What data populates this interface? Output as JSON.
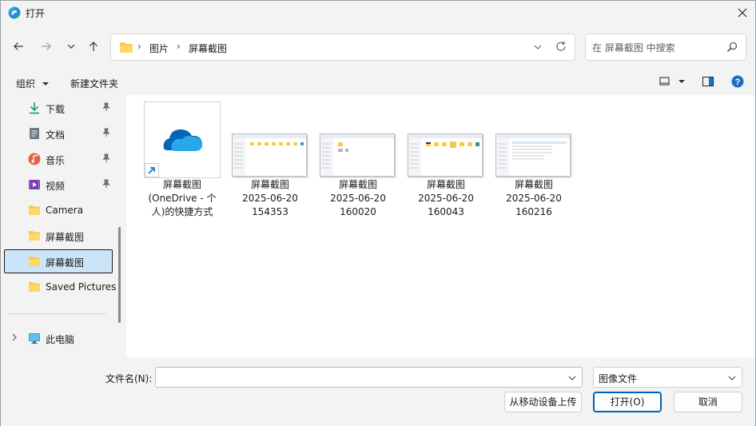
{
  "window": {
    "title": "打开"
  },
  "address": {
    "breadcrumbs": [
      "图片",
      "屏幕截图"
    ]
  },
  "search": {
    "placeholder": "在 屏幕截图 中搜索"
  },
  "commandbar": {
    "organize": "组织",
    "new_folder": "新建文件夹"
  },
  "sidebar": {
    "items": [
      {
        "label": "下载",
        "icon": "download-icon",
        "pinned": true
      },
      {
        "label": "文档",
        "icon": "document-icon",
        "pinned": true
      },
      {
        "label": "音乐",
        "icon": "music-icon",
        "pinned": true
      },
      {
        "label": "视频",
        "icon": "video-icon",
        "pinned": true
      },
      {
        "label": "Camera",
        "icon": "folder-icon",
        "pinned": false
      },
      {
        "label": "屏幕截图",
        "icon": "folder-icon",
        "pinned": false
      },
      {
        "label": "屏幕截图",
        "icon": "folder-icon",
        "pinned": false,
        "selected": true
      },
      {
        "label": "Saved Pictures",
        "icon": "folder-icon",
        "pinned": false
      }
    ],
    "this_pc": "此电脑"
  },
  "files": [
    {
      "lines": [
        "屏幕截图",
        "(OneDrive - 个",
        "人)的快捷方式"
      ],
      "kind": "shortcut"
    },
    {
      "lines": [
        "屏幕截图",
        "2025-06-20",
        "154353"
      ],
      "kind": "image"
    },
    {
      "lines": [
        "屏幕截图",
        "2025-06-20",
        "160020"
      ],
      "kind": "image"
    },
    {
      "lines": [
        "屏幕截图",
        "2025-06-20",
        "160043"
      ],
      "kind": "image"
    },
    {
      "lines": [
        "屏幕截图",
        "2025-06-20",
        "160216"
      ],
      "kind": "image"
    }
  ],
  "bottom": {
    "filename_label": "文件名(N):",
    "filename_value": "",
    "filetype": "图像文件",
    "upload_button": "从移动设备上传",
    "open_button": "打开(O)",
    "cancel_button": "取消"
  },
  "colors": {
    "accent": "#005fb8",
    "selected_bg": "#cce4f7",
    "folder": "#f8c94a"
  }
}
